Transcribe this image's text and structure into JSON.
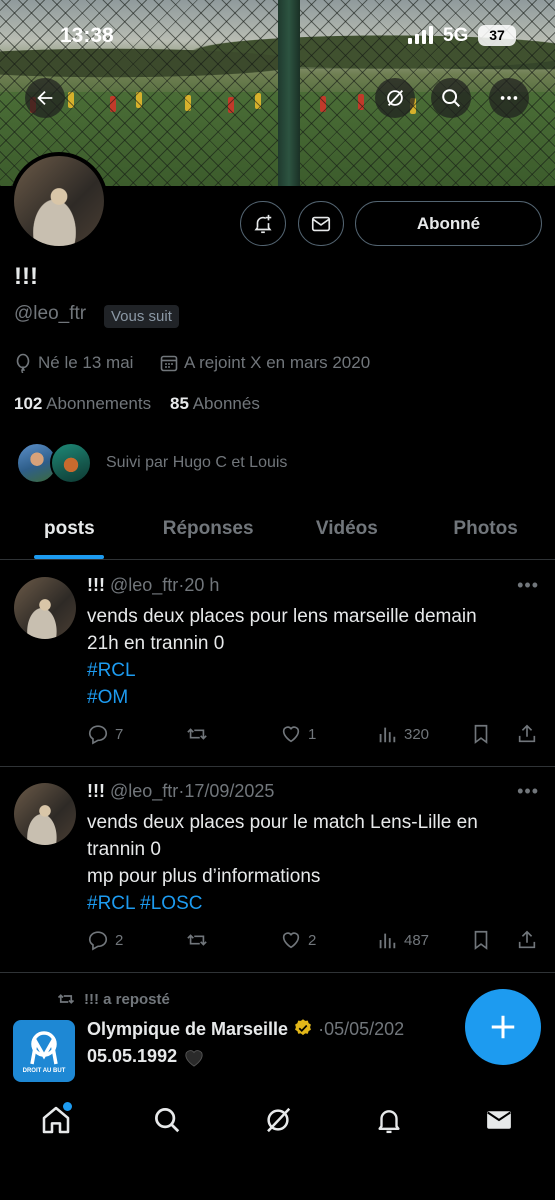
{
  "status_bar": {
    "time": "13:38",
    "network": "5G",
    "battery": "37"
  },
  "profile": {
    "display_name": "!!!",
    "handle": "@leo_ftr",
    "follows_you": "Vous suit",
    "birthday": "Né le 13 mai",
    "joined": "A rejoint X en mars 2020",
    "following_count": "102",
    "following_label": "Abonnements",
    "followers_count": "85",
    "followers_label": "Abonnés",
    "followed_by": "Suivi par Hugo C et Louis",
    "follow_button": "Abonné"
  },
  "tabs": [
    "posts",
    "Réponses",
    "Vidéos",
    "Photos"
  ],
  "posts": [
    {
      "name": "!!!",
      "handle": "@leo_ftr",
      "time": "20 h",
      "text_line1": "vends deux places pour lens marseille demain",
      "text_line2": "21h en trannin 0",
      "tag1": "#RCL",
      "tag2": "#OM",
      "replies": "7",
      "likes": "1",
      "views": "320"
    },
    {
      "name": "!!!",
      "handle": "@leo_ftr",
      "time": "17/09/2025",
      "text_line1": "vends deux places pour le match Lens-Lille en",
      "text_line2": "trannin 0",
      "text_line3": "mp pour plus d’informations",
      "tag1": "#RCL",
      "tag2": "#LOSC",
      "replies": "2",
      "likes": "2",
      "views": "487"
    }
  ],
  "repost": {
    "label": "!!! a reposté",
    "name": "Olympique de Marseille",
    "date": "05/05/202",
    "text": "05.05.1992",
    "logo_text": "DROIT AU BUT"
  },
  "colors": {
    "accent": "#1d9bf0",
    "background": "#000000",
    "muted": "#71767b"
  }
}
